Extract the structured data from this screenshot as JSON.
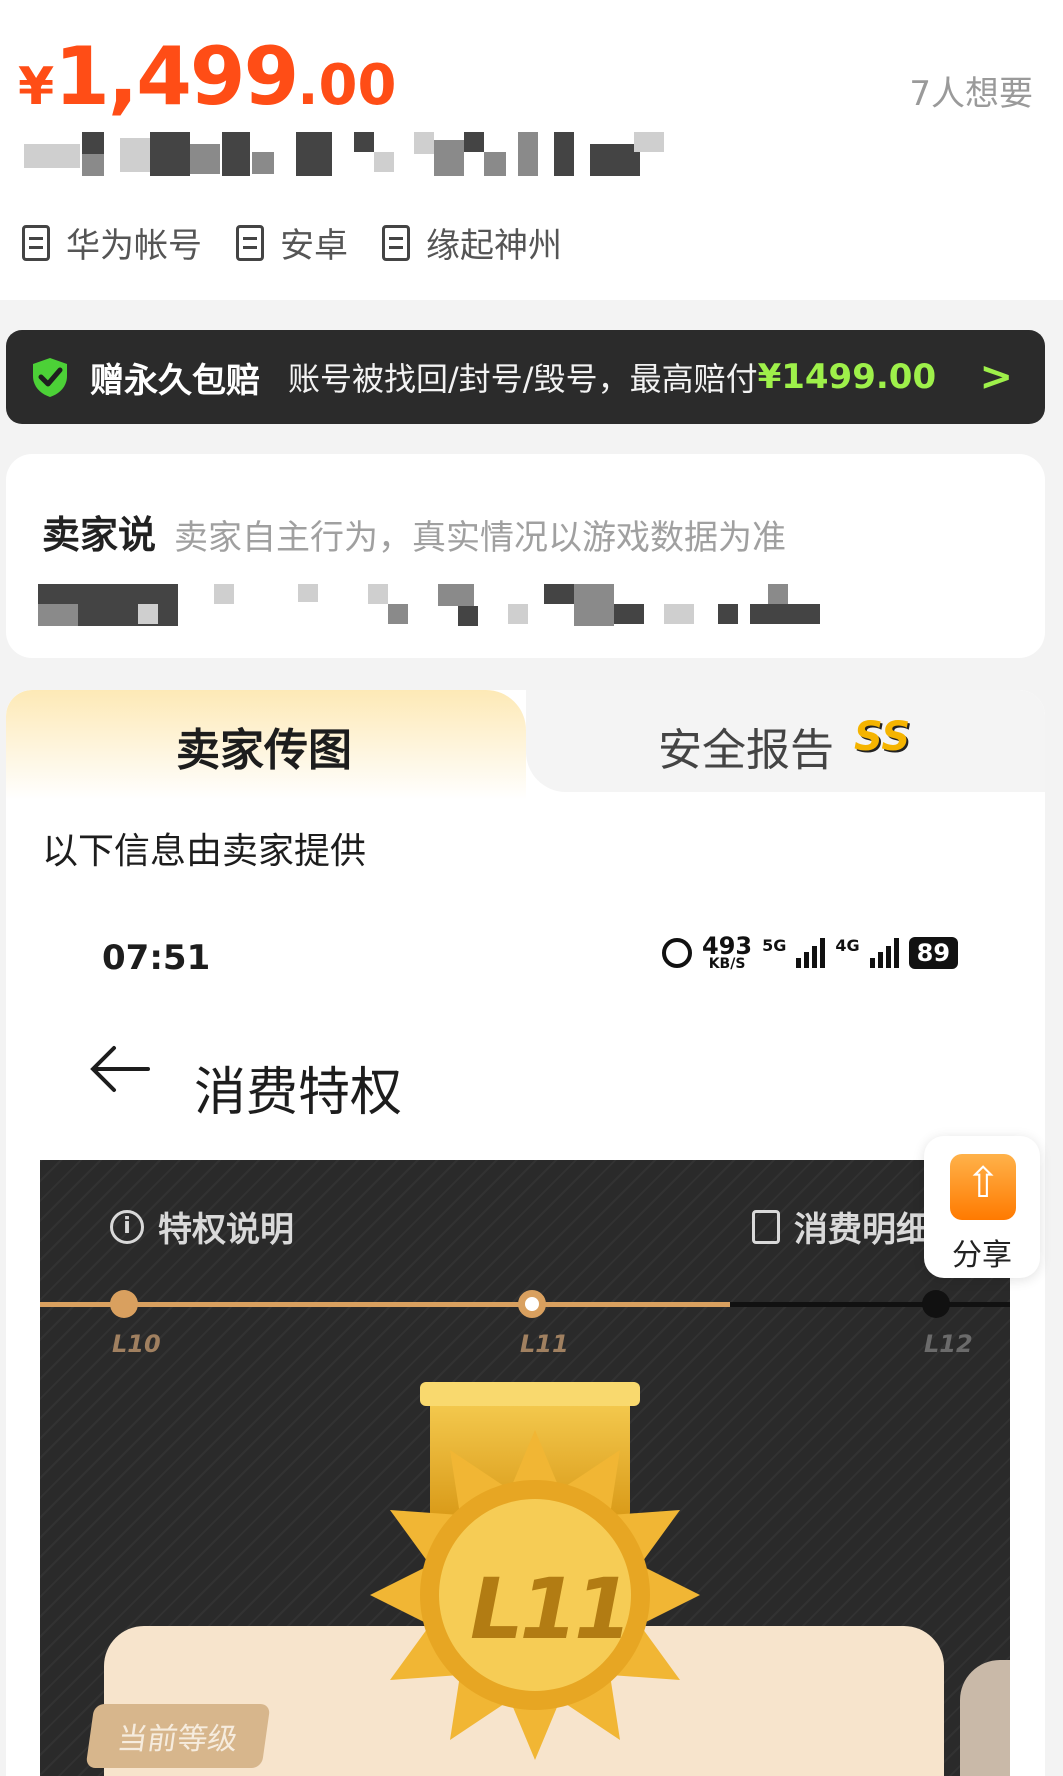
{
  "header": {
    "price_currency": "¥",
    "price_integer": "1,499",
    "price_decimal": ".00",
    "want_count": "7人想要",
    "tags": [
      {
        "label": "华为帐号",
        "icon": "document-icon"
      },
      {
        "label": "安卓",
        "icon": "document-icon"
      },
      {
        "label": "缘起神州",
        "icon": "document-icon"
      }
    ]
  },
  "guarantee": {
    "title": "赠永久包赔",
    "text": "账号被找回/封号/毁号，最高赔付",
    "amount": "¥1499.00",
    "accent_color": "#9ef04a"
  },
  "seller": {
    "title": "卖家说",
    "note": "卖家自主行为，真实情况以游戏数据为准"
  },
  "tabs": {
    "items": [
      {
        "label": "卖家传图"
      },
      {
        "label": "安全报告"
      }
    ],
    "badge": "SS",
    "provided_by": "以下信息由卖家提供"
  },
  "embedded": {
    "time": "07:51",
    "net_speed": "493",
    "net_unit": "KB/S",
    "net_5g": "5G",
    "net_4g": "4G",
    "battery": "89",
    "page_title": "消费特权",
    "privilege_info": "特权说明",
    "consume_detail": "消费明细",
    "levels": [
      "L10",
      "L11",
      "L12"
    ],
    "medal_label": "L11",
    "current_level": "当前等级"
  },
  "share": {
    "label": "分享"
  },
  "colors": {
    "price": "#ff4d16",
    "gold": "#d9a05f"
  }
}
